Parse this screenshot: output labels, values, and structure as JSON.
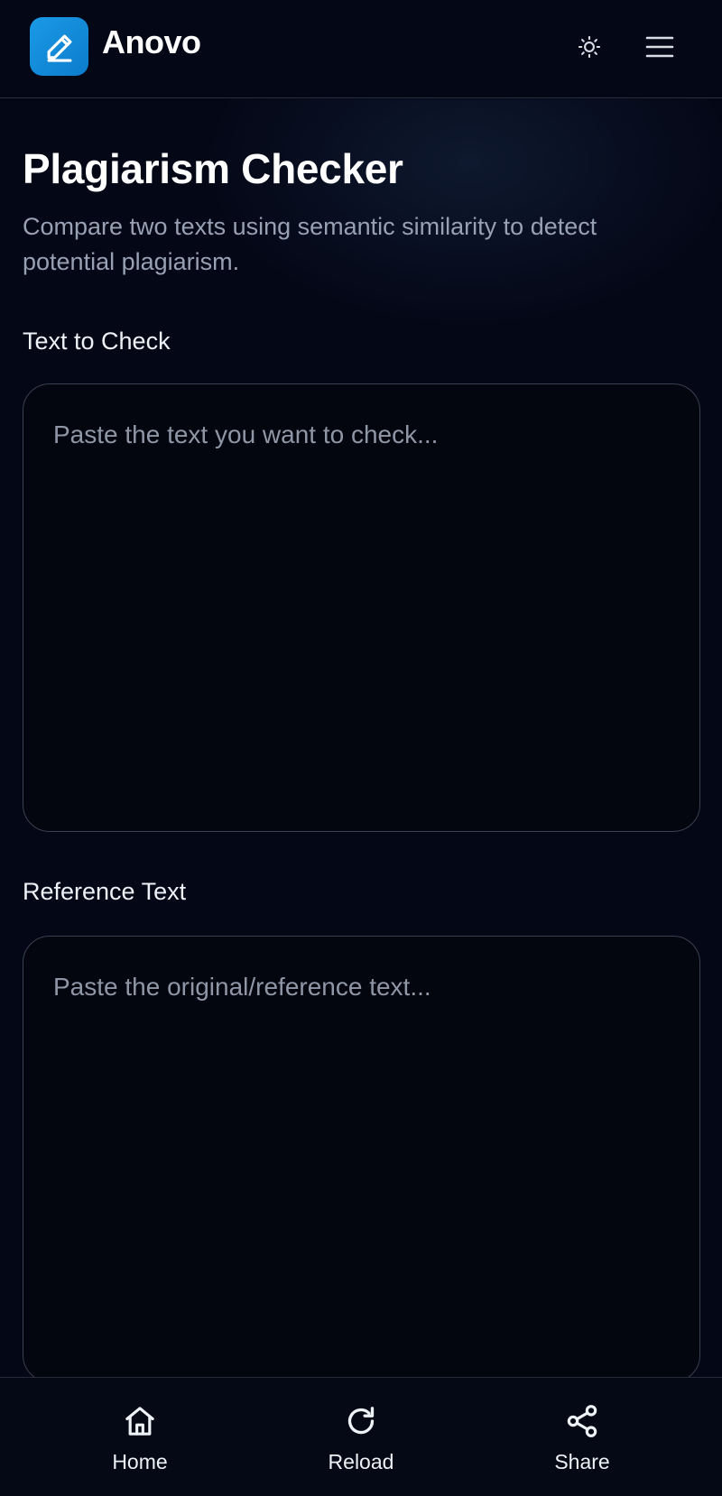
{
  "header": {
    "brand": "Anovo",
    "logo_icon": "pencil-icon",
    "theme_icon": "sun-icon",
    "menu_icon": "hamburger-menu-icon"
  },
  "main": {
    "title": "Plagiarism Checker",
    "subtitle": "Compare two texts using semantic similarity to detect potential plagiarism.",
    "check_field": {
      "label": "Text to Check",
      "value": "",
      "placeholder": "Paste the text you want to check..."
    },
    "reference_field": {
      "label": "Reference Text",
      "value": "",
      "placeholder": "Paste the original/reference text..."
    }
  },
  "bottom_nav": {
    "items": [
      {
        "label": "Home",
        "icon": "home-icon"
      },
      {
        "label": "Reload",
        "icon": "reload-icon"
      },
      {
        "label": "Share",
        "icon": "share-icon"
      }
    ]
  },
  "colors": {
    "background": "#040716",
    "accent": "#1a9ae6",
    "muted_text": "#98a1b3",
    "border": "#3a4150"
  }
}
